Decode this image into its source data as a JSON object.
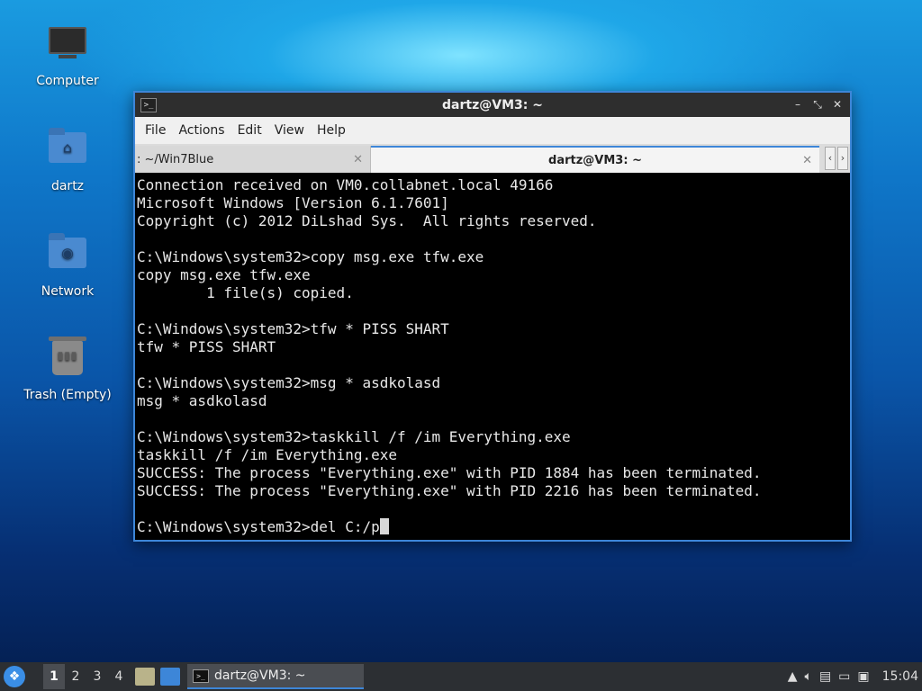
{
  "desktop": {
    "icons": [
      {
        "label": "Computer",
        "icon": "computer-icon"
      },
      {
        "label": "dartz",
        "icon": "home-folder-icon"
      },
      {
        "label": "Network",
        "icon": "network-folder-icon"
      },
      {
        "label": "Trash (Empty)",
        "icon": "trash-icon"
      }
    ]
  },
  "window": {
    "title": "dartz@VM3: ~",
    "controls": {
      "minimize": "–",
      "restore": "⤡",
      "close": "✕"
    },
    "menu": [
      "File",
      "Actions",
      "Edit",
      "View",
      "Help"
    ],
    "tabs": [
      {
        "label": ": ~/Win7Blue",
        "active": false
      },
      {
        "label": "dartz@VM3: ~",
        "active": true
      }
    ],
    "tab_nav": {
      "prev": "‹",
      "next": "›"
    },
    "terminal_lines": [
      "Connection received on VM0.collabnet.local 49166",
      "Microsoft Windows [Version 6.1.7601]",
      "Copyright (c) 2012 DiLshad Sys.  All rights reserved.",
      "",
      "C:\\Windows\\system32>copy msg.exe tfw.exe",
      "copy msg.exe tfw.exe",
      "        1 file(s) copied.",
      "",
      "C:\\Windows\\system32>tfw * PISS SHART",
      "tfw * PISS SHART",
      "",
      "C:\\Windows\\system32>msg * asdkolasd",
      "msg * asdkolasd",
      "",
      "C:\\Windows\\system32>taskkill /f /im Everything.exe",
      "taskkill /f /im Everything.exe",
      "SUCCESS: The process \"Everything.exe\" with PID 1884 has been terminated.",
      "SUCCESS: The process \"Everything.exe\" with PID 2216 has been terminated.",
      ""
    ],
    "prompt_line": "C:\\Windows\\system32>del C:/p"
  },
  "taskbar": {
    "workspaces": [
      "1",
      "2",
      "3",
      "4"
    ],
    "active_workspace": "1",
    "task_label": "dartz@VM3: ~",
    "clock": "15:04"
  },
  "colors": {
    "accent": "#3d86d8",
    "terminal_bg": "#000000",
    "terminal_fg": "#e8e8e8"
  }
}
